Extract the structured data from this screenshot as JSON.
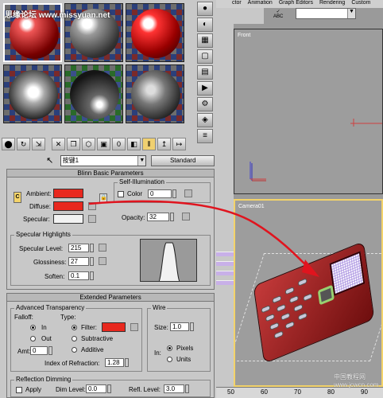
{
  "watermark": "思缘论坛 www.missyuan.net",
  "material_editor": {
    "name": "按键1",
    "shader_button": "Standard",
    "rollouts": {
      "blinn_title": "Blinn Basic Parameters",
      "extended_title": "Extended Parameters"
    },
    "self_illumination": {
      "title": "Self-Illumination",
      "color_label": "Color",
      "value": "0"
    },
    "ambient_label": "Ambient:",
    "diffuse_label": "Diffuse:",
    "specular_label": "Specular:",
    "opacity_label": "Opacity:",
    "opacity_value": "32",
    "specular_highlights": {
      "title": "Specular Highlights",
      "level_label": "Specular Level:",
      "level_value": "215",
      "gloss_label": "Glossiness:",
      "gloss_value": "27",
      "soften_label": "Soften:",
      "soften_value": "0.1"
    },
    "advanced_transparency": {
      "title": "Advanced Transparency",
      "falloff_label": "Falloff:",
      "type_label": "Type:",
      "in_label": "In",
      "out_label": "Out",
      "filter_label": "Filter:",
      "subtractive_label": "Subtractive",
      "additive_label": "Additive",
      "amt_label": "Amt:",
      "amt_value": "0",
      "ior_label": "Index of Refraction:",
      "ior_value": "1.28"
    },
    "wire": {
      "title": "Wire",
      "size_label": "Size:",
      "size_value": "1.0",
      "in_label": "In:",
      "pixels_label": "Pixels",
      "units_label": "Units"
    },
    "reflection_dimming": {
      "title": "Reflection Dimming",
      "apply_label": "Apply",
      "dim_label": "Dim Level:",
      "dim_value": "0.0",
      "refl_label": "Refl. Level:",
      "refl_value": "3.0"
    },
    "colors": {
      "ambient": "#e8281e",
      "diffuse": "#e8281e",
      "specular": "#f2f2f2",
      "filter": "#e8281e"
    }
  },
  "viewports": {
    "menu": [
      "ctor",
      "Animation",
      "Graph Editors",
      "Rendering",
      "Custom"
    ],
    "front_label": "Front",
    "camera_label": "Camera01",
    "abc_label": "ABC",
    "ruler_ticks": [
      "50",
      "60",
      "70",
      "80",
      "90"
    ]
  },
  "site_watermark": "中国教程网 www.jcwcn.com",
  "colors": {
    "annotation_arrow": "#e0141e"
  }
}
